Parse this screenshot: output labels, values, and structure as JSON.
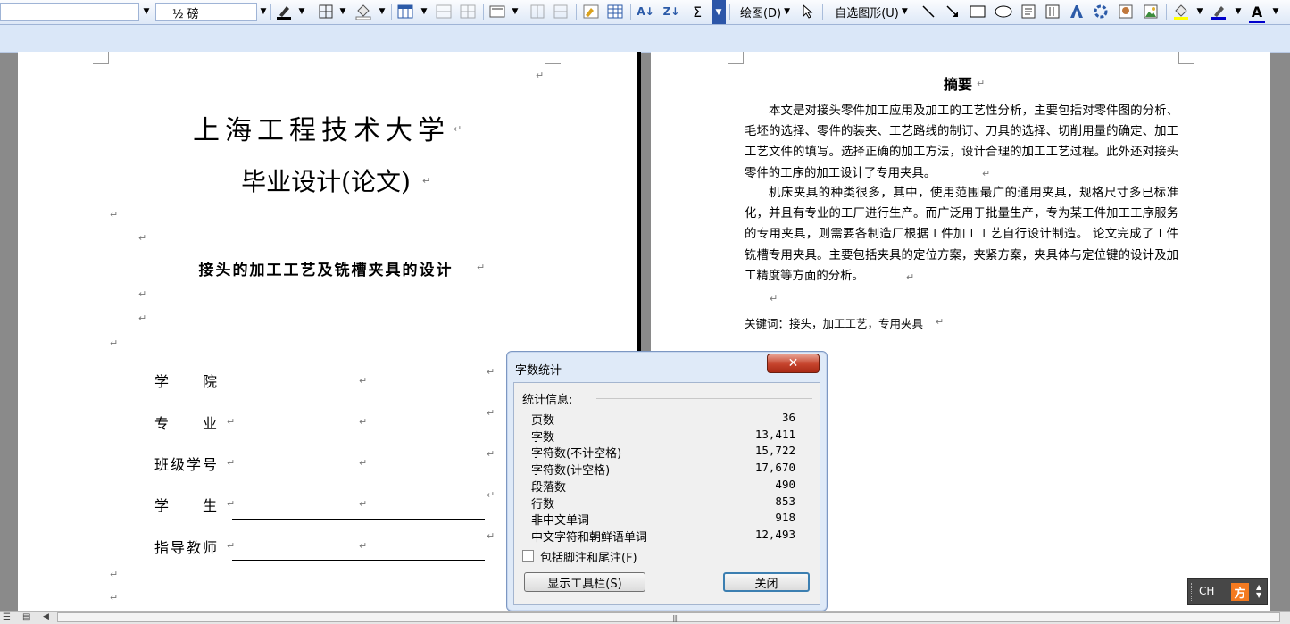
{
  "toolbar": {
    "line_width_value": "½ 磅",
    "draw_label": "绘图(D)",
    "autoshapes_label": "自选图形(U)",
    "sigma_label": "Σ"
  },
  "left_page": {
    "university": "上海工程技术大学",
    "thesis_type": "毕业设计(论文)",
    "thesis_title": "接头的加工工艺及铣槽夹具的设计",
    "fields": [
      {
        "label": "学　　院",
        "value": ""
      },
      {
        "label": "专　　业",
        "value": ""
      },
      {
        "label": "班级学号",
        "value": ""
      },
      {
        "label": "学　　生",
        "value": ""
      },
      {
        "label": "指导教师",
        "value": ""
      }
    ]
  },
  "right_page": {
    "abstract_heading": "摘要",
    "paragraph1": "本文是对接头零件加工应用及加工的工艺性分析，主要包括对零件图的分析、毛坯的选择、零件的装夹、工艺路线的制订、刀具的选择、切削用量的确定、加工工艺文件的填写。选择正确的加工方法，设计合理的加工工艺过程。此外还对接头零件的工序的加工设计了专用夹具。",
    "paragraph2": "机床夹具的种类很多，其中，使用范围最广的通用夹具，规格尺寸多已标准化，并且有专业的工厂进行生产。而广泛用于批量生产，专为某工件加工工序服务的专用夹具，则需要各制造厂根据工件加工工艺自行设计制造。 论文完成了工件铣槽专用夹具。主要包括夹具的定位方案，夹紧方案，夹具体与定位键的设计及加工精度等方面的分析。",
    "keywords": "关键词：接头，加工工艺，专用夹具"
  },
  "dialog": {
    "title": "字数统计",
    "section_label": "统计信息:",
    "stats": [
      {
        "label": "页数",
        "value": "36"
      },
      {
        "label": "字数",
        "value": "13,411"
      },
      {
        "label": "字符数(不计空格)",
        "value": "15,722"
      },
      {
        "label": "字符数(计空格)",
        "value": "17,670"
      },
      {
        "label": "段落数",
        "value": "490"
      },
      {
        "label": "行数",
        "value": "853"
      },
      {
        "label": "非中文单词",
        "value": "918"
      },
      {
        "label": "中文字符和朝鲜语单词",
        "value": "12,493"
      }
    ],
    "checkbox_label": "包括脚注和尾注(F)",
    "show_toolbar_button": "显示工具栏(S)",
    "close_button": "关闭"
  },
  "ime": {
    "label": "CH"
  },
  "colors": {
    "accent": "#dae7f8",
    "close_red": "#c5432c",
    "highlight": "#ffff00",
    "font_color": "#0000cc"
  }
}
